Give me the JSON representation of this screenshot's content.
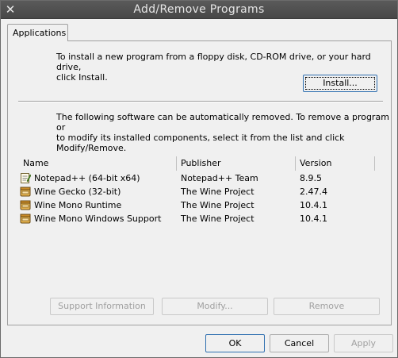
{
  "window": {
    "title": "Add/Remove Programs",
    "close_glyph": "✕"
  },
  "tabs": [
    {
      "label": "Applications",
      "selected": true
    }
  ],
  "install_section": {
    "instructions_line1": "To install a new program from a floppy disk, CD-ROM drive, or your hard drive,",
    "instructions_line2": "click Install.",
    "install_button": "Install..."
  },
  "remove_section": {
    "instructions_line1": "The following software can be automatically removed. To remove a program or",
    "instructions_line2": "to modify its installed components, select it from the list and click",
    "instructions_line3": "Modify/Remove."
  },
  "list": {
    "columns": [
      "Name",
      "Publisher",
      "Version"
    ],
    "rows": [
      {
        "name": "Notepad++ (64-bit x64)",
        "publisher": "Notepad++ Team",
        "version": "8.9.5",
        "icon": "notepad-icon"
      },
      {
        "name": "Wine Gecko (32-bit)",
        "publisher": "The Wine Project",
        "version": "2.47.4",
        "icon": "package-icon"
      },
      {
        "name": "Wine Mono Runtime",
        "publisher": "The Wine Project",
        "version": "10.4.1",
        "icon": "package-icon"
      },
      {
        "name": "Wine Mono Windows Support",
        "publisher": "The Wine Project",
        "version": "10.4.1",
        "icon": "package-icon"
      }
    ]
  },
  "action_buttons": {
    "support": "Support Information",
    "modify": "Modify...",
    "remove": "Remove"
  },
  "dialog_buttons": {
    "ok": "OK",
    "cancel": "Cancel",
    "apply": "Apply"
  },
  "colors": {
    "titlebar": "#4f4f4f",
    "focus_border": "#2f6fb0",
    "disabled_text": "#a0a0a0"
  }
}
